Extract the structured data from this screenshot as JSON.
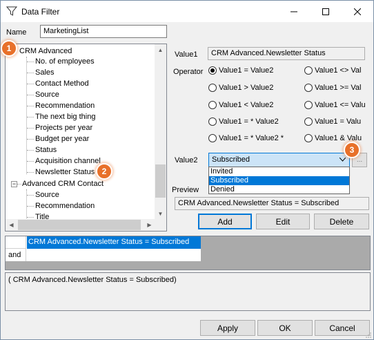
{
  "window": {
    "title": "Data Filter"
  },
  "name_field": {
    "label": "Name",
    "value": "MarketingList"
  },
  "tree": {
    "root1": "CRM Advanced",
    "children1": [
      "No. of employees",
      "Sales",
      "Contact Method",
      "Source",
      "Recommendation",
      "The next big thing",
      "Projects per year",
      "Budget per year",
      "Status",
      "Acquisition channel",
      "Newsletter Status"
    ],
    "root2": "Advanced CRM Contact",
    "children2": [
      "Source",
      "Recommendation",
      "Title"
    ]
  },
  "condition": {
    "value1_label": "Value1",
    "value1": "CRM Advanced.Newsletter Status",
    "operator_label": "Operator",
    "operators": [
      {
        "label": "Value1 = Value2",
        "checked": true
      },
      {
        "label": "Value1 <> Val",
        "checked": false
      },
      {
        "label": "Value1 > Value2",
        "checked": false
      },
      {
        "label": "Value1 >= Val",
        "checked": false
      },
      {
        "label": "Value1 < Value2",
        "checked": false
      },
      {
        "label": "Value1 <= Valu",
        "checked": false
      },
      {
        "label": "Value1 = * Value2",
        "checked": false
      },
      {
        "label": "Value1 = Valu",
        "checked": false
      },
      {
        "label": "Value1 = * Value2 *",
        "checked": false
      },
      {
        "label": "Value1 & Valu",
        "checked": false
      }
    ],
    "value2_label": "Value2",
    "value2": "Subscribed",
    "options": [
      "Invited",
      "Subscribed",
      "Denied"
    ],
    "ellipsis": "..."
  },
  "preview": {
    "label": "Preview",
    "text": "CRM Advanced.Newsletter Status =  Subscribed"
  },
  "actions": {
    "add": "Add",
    "edit": "Edit",
    "delete": "Delete"
  },
  "filter_list": {
    "row1": "CRM Advanced.Newsletter Status = Subscribed",
    "row2_op": "and"
  },
  "expression": "( CRM Advanced.Newsletter Status = Subscribed)",
  "footer": {
    "apply": "Apply",
    "ok": "OK",
    "cancel": "Cancel"
  },
  "badges": [
    "1",
    "2",
    "3"
  ],
  "colors": {
    "accent": "#0078d7",
    "badge": "#e8702a"
  }
}
